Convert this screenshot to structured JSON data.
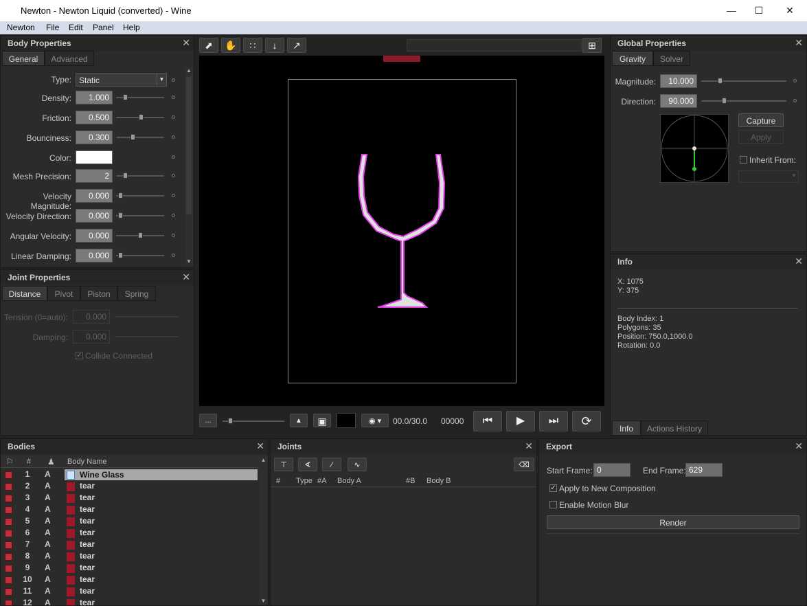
{
  "window": {
    "title": "Newton - Newton Liquid (converted) - Wine"
  },
  "menu": [
    "Newton",
    "File",
    "Edit",
    "Panel",
    "Help"
  ],
  "body_properties": {
    "title": "Body Properties",
    "tabs": [
      "General",
      "Advanced"
    ],
    "type_label": "Type:",
    "type_value": "Static",
    "density_label": "Density:",
    "density": "1.000",
    "friction_label": "Friction:",
    "friction": "0.500",
    "bounciness_label": "Bounciness:",
    "bounciness": "0.300",
    "color_label": "Color:",
    "color_value": "#ffffff",
    "mesh_label": "Mesh Precision:",
    "mesh": "2",
    "velmag_label": "Velocity Magnitude:",
    "velmag": "0.000",
    "veldir_label": "Velocity Direction:",
    "veldir": "0.000",
    "angvel_label": "Angular Velocity:",
    "angvel": "0.000",
    "lindamp_label": "Linear Damping:",
    "lindamp": "0.000"
  },
  "joint_properties": {
    "title": "Joint Properties",
    "tabs": [
      "Distance",
      "Pivot",
      "Piston",
      "Spring"
    ],
    "tension_label": "Tension (0=auto):",
    "tension": "0.000",
    "damping_label": "Damping:",
    "damping": "0.000",
    "collide_label": "Collide Connected"
  },
  "viewer": {
    "time": "00.0/30.0",
    "frame": "00000"
  },
  "global_properties": {
    "title": "Global Properties",
    "tabs": [
      "Gravity",
      "Solver"
    ],
    "magnitude_label": "Magnitude:",
    "magnitude": "10.000",
    "direction_label": "Direction:",
    "direction": "90.000",
    "capture": "Capture",
    "apply": "Apply",
    "inherit": "Inherit From:"
  },
  "info": {
    "title": "Info",
    "x": "X: 1075",
    "y": "Y: 375",
    "body_index": "Body Index: 1",
    "polygons": "Polygons: 35",
    "position": "Position: 750.0,1000.0",
    "rotation": "Rotation: 0.0",
    "tabs": [
      "Info",
      "Actions History"
    ]
  },
  "bodies": {
    "title": "Bodies",
    "headers": {
      "num": "#",
      "name": "Body Name"
    },
    "rows": [
      {
        "n": "1",
        "a": "A",
        "name": "Wine Glass"
      },
      {
        "n": "2",
        "a": "A",
        "name": "tear"
      },
      {
        "n": "3",
        "a": "A",
        "name": "tear"
      },
      {
        "n": "4",
        "a": "A",
        "name": "tear"
      },
      {
        "n": "5",
        "a": "A",
        "name": "tear"
      },
      {
        "n": "6",
        "a": "A",
        "name": "tear"
      },
      {
        "n": "7",
        "a": "A",
        "name": "tear"
      },
      {
        "n": "8",
        "a": "A",
        "name": "tear"
      },
      {
        "n": "9",
        "a": "A",
        "name": "tear"
      },
      {
        "n": "10",
        "a": "A",
        "name": "tear"
      },
      {
        "n": "11",
        "a": "A",
        "name": "tear"
      },
      {
        "n": "12",
        "a": "A",
        "name": "tear"
      }
    ]
  },
  "joints": {
    "title": "Joints",
    "headers": [
      "#",
      "Type",
      "#A",
      "Body A",
      "#B",
      "Body B"
    ]
  },
  "export": {
    "title": "Export",
    "start_label": "Start Frame:",
    "start": "0",
    "end_label": "End Frame:",
    "end": "629",
    "apply_comp": "Apply to New Composition",
    "motion_blur": "Enable Motion Blur",
    "render": "Render"
  }
}
